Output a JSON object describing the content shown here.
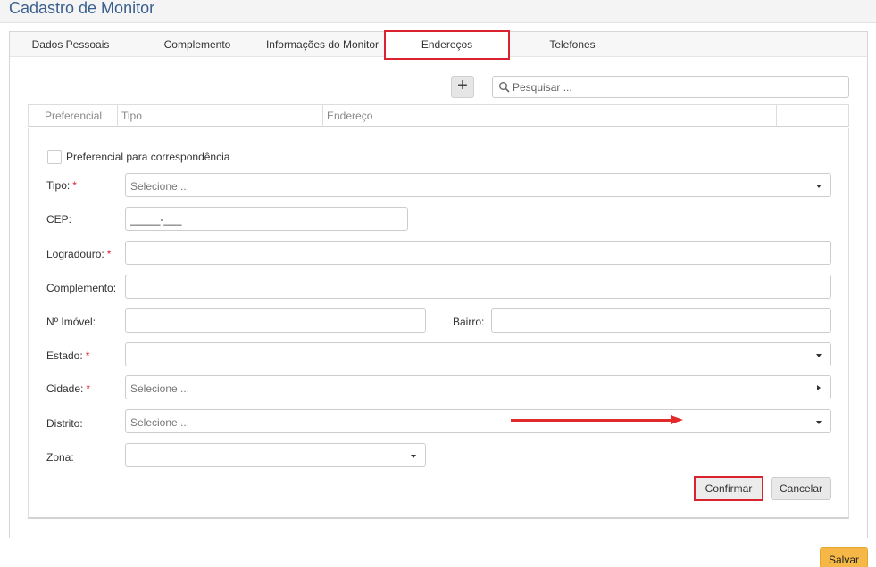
{
  "page": {
    "title": "Cadastro de Monitor"
  },
  "tabs": [
    {
      "label": "Dados Pessoais",
      "active": false
    },
    {
      "label": "Complemento",
      "active": false
    },
    {
      "label": "Informações do Monitor",
      "active": false
    },
    {
      "label": "Endereços",
      "active": true
    },
    {
      "label": "Telefones",
      "active": false
    }
  ],
  "toolbar": {
    "add_label": "+",
    "search_placeholder": "Pesquisar ..."
  },
  "table": {
    "columns": [
      "Preferencial",
      "Tipo",
      "Endereço",
      ""
    ]
  },
  "form": {
    "checkbox_label": "Preferencial para correspondência",
    "required_mark": "*",
    "tipo": {
      "label": "Tipo:",
      "placeholder": "Selecione ..."
    },
    "cep": {
      "label": "CEP:",
      "value": "_____-___"
    },
    "logradouro": {
      "label": "Logradouro:",
      "value": ""
    },
    "complemento": {
      "label": "Complemento:",
      "value": ""
    },
    "numero": {
      "label": "Nº Imóvel:",
      "value": ""
    },
    "bairro": {
      "label": "Bairro:",
      "value": ""
    },
    "estado": {
      "label": "Estado:",
      "value": ""
    },
    "cidade": {
      "label": "Cidade:",
      "placeholder": "Selecione ..."
    },
    "distrito": {
      "label": "Distrito:",
      "placeholder": "Selecione ..."
    },
    "zona": {
      "label": "Zona:",
      "value": ""
    },
    "confirm_label": "Confirmar",
    "cancel_label": "Cancelar"
  },
  "footer": {
    "save_label": "Salvar"
  },
  "colors": {
    "highlight": "#d9242f",
    "title": "#3a5f8f",
    "save": "#f5b746"
  }
}
